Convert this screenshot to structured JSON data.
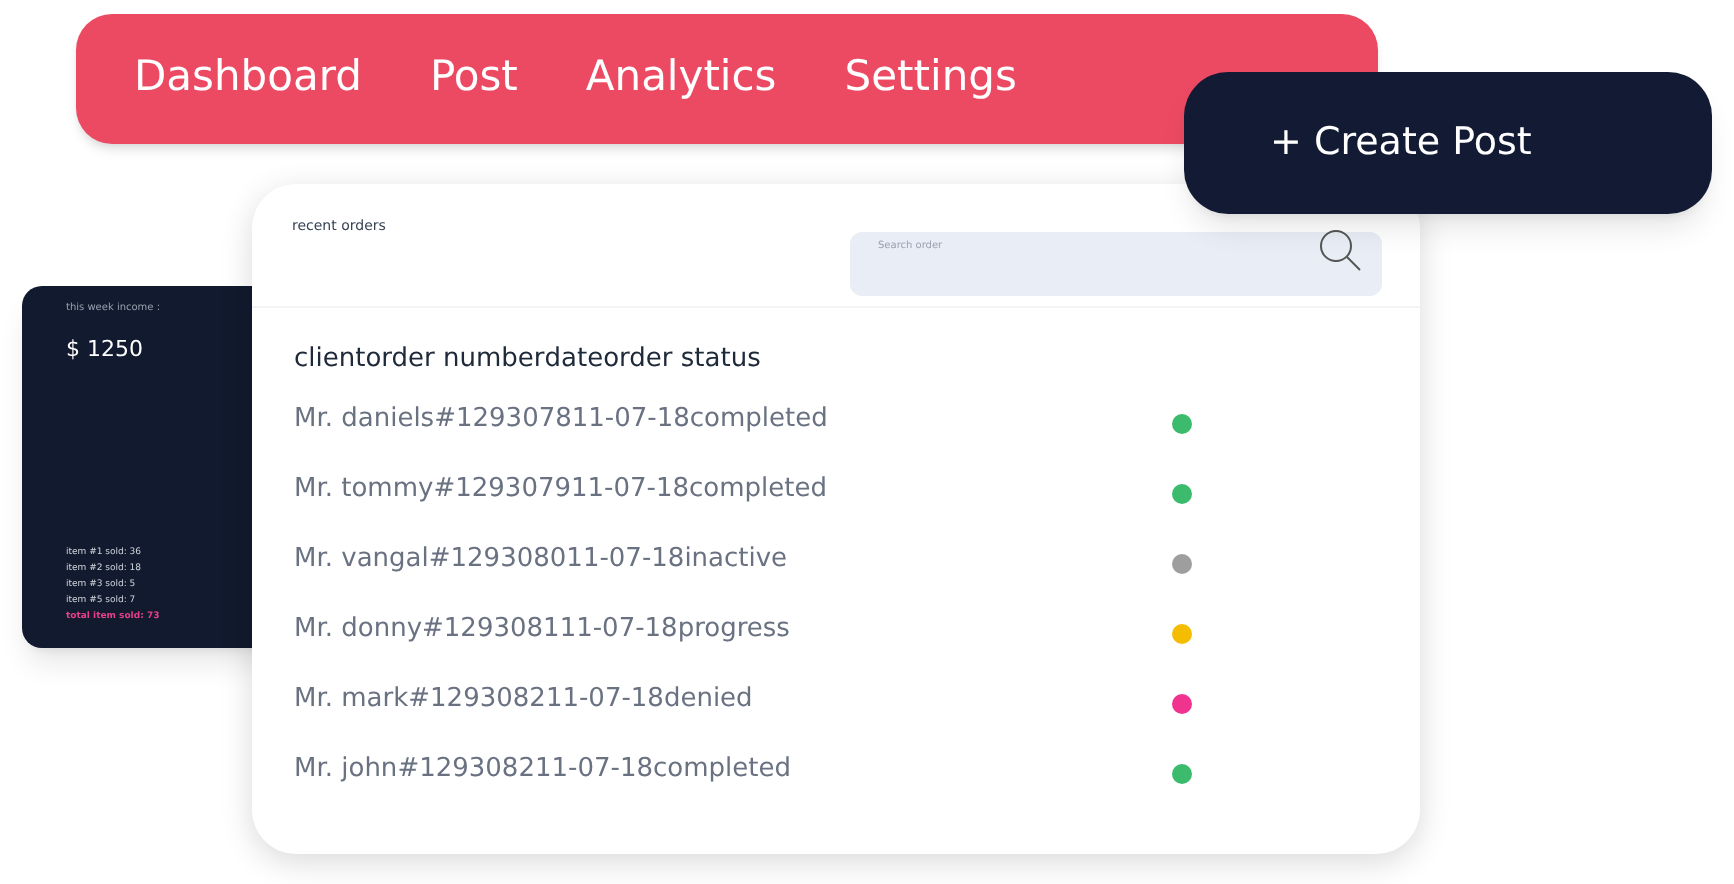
{
  "nav": {
    "items": [
      {
        "label": "Dashboard"
      },
      {
        "label": "Post"
      },
      {
        "label": "Analytics"
      },
      {
        "label": "Settings"
      }
    ]
  },
  "create_button": {
    "label": "+ Create Post"
  },
  "income_card": {
    "title": "this week income :",
    "amount": "$ 1250",
    "items": [
      "item #1 sold: 36",
      "item #2 sold: 18",
      "item #3 sold: 5",
      "item #5 sold: 7"
    ],
    "total": "total item sold: 73"
  },
  "orders": {
    "title": "recent orders",
    "search": {
      "placeholder": "Search order"
    },
    "columns": [
      "client",
      "order number",
      "date",
      "order status"
    ],
    "rows": [
      {
        "client": "Mr. daniels",
        "order": "#1293078",
        "date": "11-07-18",
        "status": "completed",
        "color": "#3dbb6c"
      },
      {
        "client": "Mr. tommy",
        "order": "#1293079",
        "date": "11-07-18",
        "status": "completed",
        "color": "#3dbb6c"
      },
      {
        "client": "Mr. vangal",
        "order": "#1293080",
        "date": "11-07-18",
        "status": "inactive",
        "color": "#9e9e9e"
      },
      {
        "client": "Mr. donny",
        "order": "#1293081",
        "date": "11-07-18",
        "status": "progress",
        "color": "#f5bd02"
      },
      {
        "client": "Mr. mark",
        "order": "#1293082",
        "date": "11-07-18",
        "status": "denied",
        "color": "#f0338e"
      },
      {
        "client": "Mr. john",
        "order": "#1293082",
        "date": "11-07-18",
        "status": "completed",
        "color": "#3dbb6c"
      }
    ]
  }
}
